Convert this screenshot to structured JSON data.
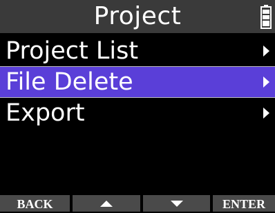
{
  "header": {
    "title": "Project",
    "battery_icon": "battery-icon"
  },
  "menu": {
    "items": [
      {
        "label": "Project List",
        "selected": false,
        "icon": "chevron-right-icon"
      },
      {
        "label": "File Delete",
        "selected": true,
        "icon": "chevron-right-icon"
      },
      {
        "label": "Export",
        "selected": false,
        "icon": "chevron-right-icon"
      }
    ]
  },
  "function_keys": {
    "back_label": "BACK",
    "up_icon": "triangle-up-icon",
    "down_icon": "triangle-down-icon",
    "enter_label": "ENTER"
  },
  "colors": {
    "selection": "#5a3fd8",
    "title_bar": "#3a3a3a",
    "function_key": "#4a4a4a"
  }
}
